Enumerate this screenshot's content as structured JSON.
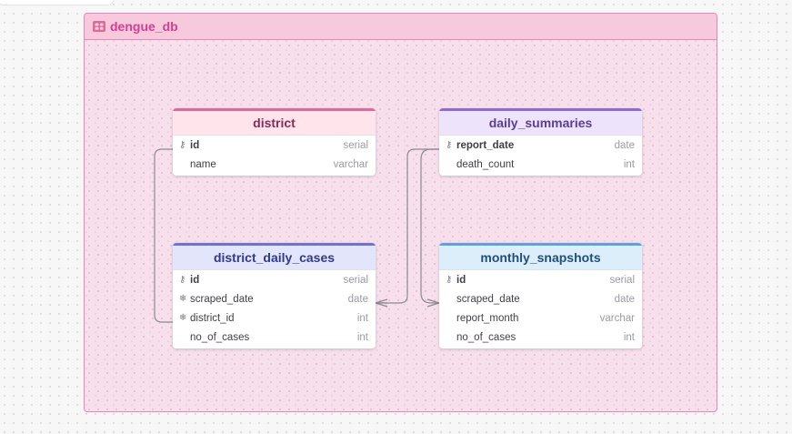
{
  "group": {
    "title": "dengue_db",
    "color": "#d53f8c",
    "icon": "grid-group-icon"
  },
  "tables": {
    "district": {
      "name": "district",
      "header_color": "#ffe4ec",
      "accent": "#e0699a",
      "title_color": "#8b2a55",
      "fields": [
        {
          "name": "id",
          "type": "serial",
          "icon": "key-icon"
        },
        {
          "name": "name",
          "type": "varchar",
          "icon": ""
        }
      ]
    },
    "daily_summaries": {
      "name": "daily_summaries",
      "header_color": "#ede4fb",
      "accent": "#8b6bd6",
      "title_color": "#5b3c9a",
      "fields": [
        {
          "name": "report_date",
          "type": "date",
          "icon": "key-icon"
        },
        {
          "name": "death_count",
          "type": "int",
          "icon": ""
        }
      ]
    },
    "district_daily_cases": {
      "name": "district_daily_cases",
      "header_color": "#e3e6fb",
      "accent": "#6b74d6",
      "title_color": "#2f3a8a",
      "fields": [
        {
          "name": "id",
          "type": "serial",
          "icon": "key-icon"
        },
        {
          "name": "scraped_date",
          "type": "date",
          "icon": "index-icon"
        },
        {
          "name": "district_id",
          "type": "int",
          "icon": "index-icon"
        },
        {
          "name": "no_of_cases",
          "type": "int",
          "icon": ""
        }
      ]
    },
    "monthly_snapshots": {
      "name": "monthly_snapshots",
      "header_color": "#ddeefb",
      "accent": "#5aa3dc",
      "title_color": "#1f4f7a",
      "fields": [
        {
          "name": "id",
          "type": "serial",
          "icon": "key-icon"
        },
        {
          "name": "scraped_date",
          "type": "date",
          "icon": ""
        },
        {
          "name": "report_month",
          "type": "varchar",
          "icon": ""
        },
        {
          "name": "no_of_cases",
          "type": "int",
          "icon": ""
        }
      ]
    }
  }
}
